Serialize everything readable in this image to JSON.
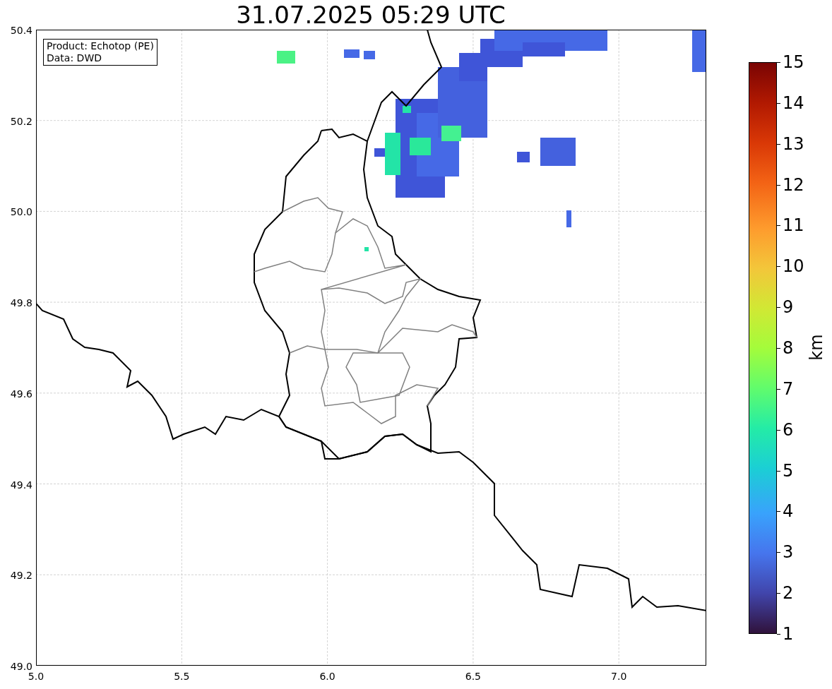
{
  "title": "31.07.2025 05:29 UTC",
  "info_box": {
    "lines": [
      "Product: Echotop (PE)",
      "Data: DWD"
    ]
  },
  "map": {
    "xticks": [
      "5.0",
      "5.5",
      "6.0",
      "6.5",
      "7.0"
    ],
    "yticks": [
      "50.4",
      "50.2",
      "50.0",
      "49.8",
      "49.6",
      "49.4",
      "49.2",
      "49.0"
    ]
  },
  "colorbar": {
    "label": "km",
    "ticks": [
      "15",
      "14",
      "13",
      "12",
      "11",
      "10",
      "9",
      "8",
      "7",
      "6",
      "5",
      "4",
      "3",
      "2",
      "1"
    ]
  }
}
